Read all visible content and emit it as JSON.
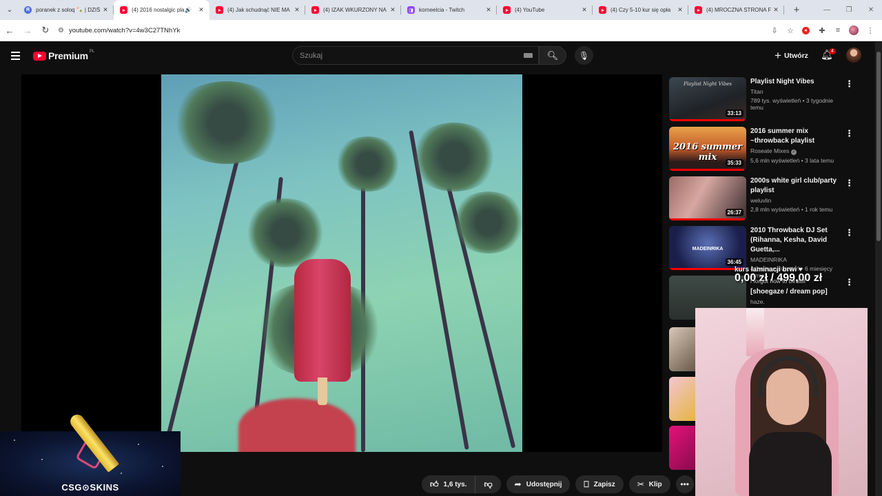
{
  "browser": {
    "tabs": [
      {
        "title": "poranek z soloq 🍡 | DZIŚ",
        "icon": "r-icon",
        "active": false
      },
      {
        "title": "(4) 2016 nostalgic pla",
        "icon": "youtube-icon",
        "active": true,
        "audio": true
      },
      {
        "title": "(4) Jak schudnąć NIE MA",
        "icon": "youtube-icon",
        "active": false
      },
      {
        "title": "(4) IZAK WKURZONY NA",
        "icon": "youtube-icon",
        "active": false
      },
      {
        "title": "korneelcia - Twitch",
        "icon": "twitch-icon",
        "active": false
      },
      {
        "title": "(4) YouTube",
        "icon": "youtube-icon",
        "active": false
      },
      {
        "title": "(4) Czy 5-10 kur się opła",
        "icon": "youtube-icon",
        "active": false
      },
      {
        "title": "(4) MROCZNA STRONA F",
        "icon": "youtube-icon",
        "active": false
      }
    ],
    "url": "youtube.com/watch?v=4w3C27TNhYk"
  },
  "header": {
    "logo_text": "Premium",
    "region": "PL",
    "search_placeholder": "Szukaj",
    "create_label": "Utwórz",
    "notifications_count": "4"
  },
  "actions": {
    "likes": "1,6 tys.",
    "share": "Udostępnij",
    "save": "Zapisz",
    "clip": "Klip"
  },
  "recommendations": [
    {
      "title": "Playlist Night Vibes",
      "channel": "Titan",
      "stats": "789 tys. wyświetleń • 3 tygodnie temu",
      "duration": "33:13",
      "thumb_text": "Playlist Night Vibes",
      "progress": 0.98
    },
    {
      "title": "2016 summer mix ~throwback playlist",
      "channel": "Roseate Mixes",
      "stats": "5,6 mln wyświetleń • 3 lata temu",
      "duration": "35:33",
      "thumb_text": "2016 summer mix",
      "progress": 0.97
    },
    {
      "title": "2000s white girl club/party playlist",
      "channel": "weluvlin",
      "stats": "2,8 mln wyświetleń • 1 rok temu",
      "duration": "26:37",
      "progress": 0.98
    },
    {
      "title": "2010 Throwback DJ Set (Rihanna, Kesha, David Guetta,...",
      "channel": "MADEINRIKA",
      "stats": "4,3 mln wyświetleń • 6 miesięcy temu",
      "duration": "36:45",
      "thumb_text": "MADEINRIKA",
      "progress": 0.97
    }
  ],
  "partial_recommendation": {
    "title": "[shoegaze / dream pop]",
    "channel": "haze."
  },
  "stream_overlay": {
    "donation_title": "kurs laminacji brwi ♥",
    "donation_amount": "0,00 zł / 499,00 zł",
    "overlay_line": "i forgot how to be still",
    "sponsor": "CSG⊙SKINS"
  },
  "colors": {
    "youtube_red": "#ff0033",
    "background": "#0f0f0f",
    "pill": "#272727"
  }
}
